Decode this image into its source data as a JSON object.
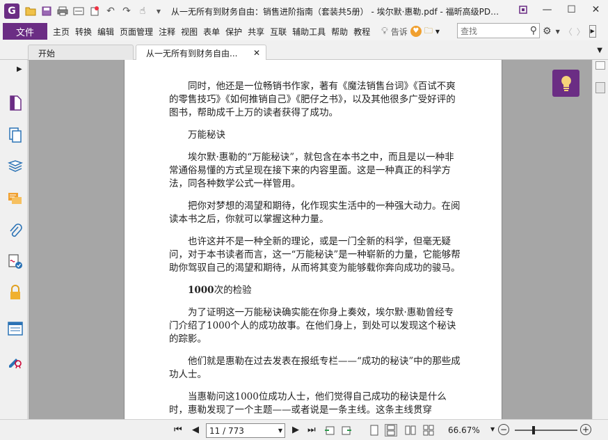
{
  "titlebar": {
    "title": "从一无所有到财务自由：销售进阶指南（套装共5册） - 埃尔默·惠勒.pdf - 福昕高级PD…",
    "logo_letter": "G",
    "qa_icons": [
      "open-folder-icon",
      "save-icon",
      "print-icon",
      "scan-icon",
      "new-icon",
      "undo-icon",
      "redo-icon",
      "hand-tool-icon"
    ],
    "window_controls": [
      "restore-icon",
      "minimize-icon",
      "maximize-icon",
      "close-icon"
    ]
  },
  "menubar": {
    "file_label": "文件",
    "items": [
      "主页",
      "转换",
      "编辑",
      "页面管理",
      "注释",
      "视图",
      "表单",
      "保护",
      "共享",
      "互联",
      "辅助工具",
      "帮助",
      "教程"
    ],
    "tell_me_label": "告诉",
    "search_placeholder": "查找"
  },
  "tabs": {
    "home_label": "开始",
    "doc_label": "从一无所有到财务自由..."
  },
  "sidebar": {
    "icons": [
      "page-icon",
      "pages-icon",
      "layers-icon",
      "comments-icon",
      "attachments-icon",
      "signature-icon",
      "security-icon",
      "form-fields-icon",
      "certificate-icon"
    ]
  },
  "document": {
    "paragraphs": [
      {
        "text": "同时，他还是一位畅销书作家，著有《魔法销售台词》《百试不爽的零售技巧》《如何推销自己》《肥仔之书》，以及其他很多广受好评的图书，帮助成千上万的读者获得了成功。",
        "indent": true
      },
      {
        "text": "万能秘诀",
        "indent": true
      },
      {
        "text": "埃尔默·惠勒的“万能秘诀”，就包含在本书之中，而且是以一种非常通俗易懂的方式呈现在接下来的内容里面。这是一种真正的科学方法，同各种数学公式一样管用。",
        "indent": true
      },
      {
        "text": "把你对梦想的渴望和期待，化作现实生活中的一种强大动力。在阅读本书之后，你就可以掌握这种力量。",
        "indent": true
      },
      {
        "text": "也许这并不是一种全新的理论，或是一门全新的科学，但毫无疑问，对于本书读者而言，这一“万能秘诀”是一种崭新的力量，它能够帮助你驾驭自己的渴望和期待，从而将其变为能够载你奔向成功的骏马。",
        "indent": true
      },
      {
        "text_bold": "1000",
        "text": "次的检验",
        "indent": true
      },
      {
        "text": "为了证明这一万能秘诀确实能在你身上奏效，埃尔默·惠勒曾经专门介绍了1000个人的成功故事。在他们身上，到处可以发现这个秘诀的踪影。",
        "indent": true
      },
      {
        "text": "他们就是惠勒在过去发表在报纸专栏——“成功的秘诀”中的那些成功人士。",
        "indent": true
      },
      {
        "text": "当惠勒问这1000位成功人士，他们觉得自己成功的秘诀是什么时，惠勒发现了一个主题——或者说是一条主线。这条主线贯穿",
        "indent": true
      }
    ]
  },
  "statusbar": {
    "page_indicator": "11 / 773",
    "zoom": "66.67%",
    "zoom_level_fraction": 0.3
  },
  "colors": {
    "accent": "#6b2d84",
    "viewport_bg": "#a6a6a6"
  }
}
